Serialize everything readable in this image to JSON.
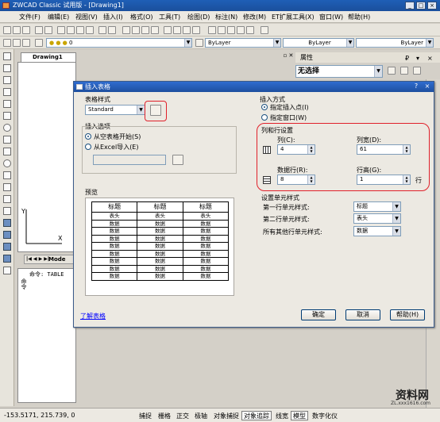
{
  "window": {
    "title": "ZWCAD Classic 试用版 - [Drawing1]",
    "min": "_",
    "max": "□",
    "close": "×"
  },
  "menu": [
    "文件(F)",
    "编辑(E)",
    "视图(V)",
    "插入(I)",
    "格式(O)",
    "工具(T)",
    "绘图(D)",
    "标注(N)",
    "修改(M)",
    "ET扩展工具(X)",
    "窗口(W)",
    "帮助(H)"
  ],
  "toolbar": {
    "layer_value": "0",
    "color": "ByLayer",
    "linetype": "ByLayer",
    "lineweight": "ByLayer"
  },
  "doc_tab": "Drawing1",
  "properties": {
    "title": "属性",
    "selection": "无选择"
  },
  "model_tabs": "Mode",
  "command_line": "命令: TABLE",
  "command_label": "命令",
  "status": {
    "coords": "-153.5171, 215.739, 0",
    "buttons": [
      "捕捉",
      "栅格",
      "正交",
      "极轴",
      "对象捕捉",
      "对象追踪",
      "线宽",
      "模型",
      "数字化仪"
    ],
    "on": [
      "对象追踪",
      "模型"
    ]
  },
  "watermark": {
    "brand": "资料网",
    "url": "ZL.xxx1616.com"
  },
  "dialog": {
    "title": "插入表格",
    "help_btn": "?",
    "close_btn": "×",
    "table_style_label": "表格样式",
    "table_style_value": "Standard",
    "insert_options_label": "插入选项",
    "from_empty": "从空表格开始(S)",
    "from_excel": "从Excel导入(E)",
    "preview_label": "预览",
    "preview": {
      "header": [
        "标题",
        "标题",
        "标题"
      ],
      "subheader": [
        "表头",
        "表头",
        "表头"
      ],
      "rows": 8,
      "cell": "数据"
    },
    "insert_method_label": "插入方式",
    "insert_point": "指定插入点(I)",
    "insert_window": "指定窗口(W)",
    "colrow_label": "列和行设置",
    "cols_label": "列(C):",
    "cols_value": "4",
    "colwidth_label": "列宽(D):",
    "colwidth_value": "61",
    "datarows_label": "数据行(R):",
    "datarows_value": "8",
    "rowheight_label": "行高(G):",
    "rowheight_value": "1",
    "rowheight_unit": "行",
    "cellstyle_label": "设置单元样式",
    "first_row_label": "第一行单元样式:",
    "first_row_value": "标题",
    "second_row_label": "第二行单元样式:",
    "second_row_value": "表头",
    "other_rows_label": "所有其他行单元样式:",
    "other_rows_value": "数据",
    "ok": "确定",
    "cancel": "取消",
    "help": "帮助(H)",
    "learn_link": "了解表格"
  }
}
